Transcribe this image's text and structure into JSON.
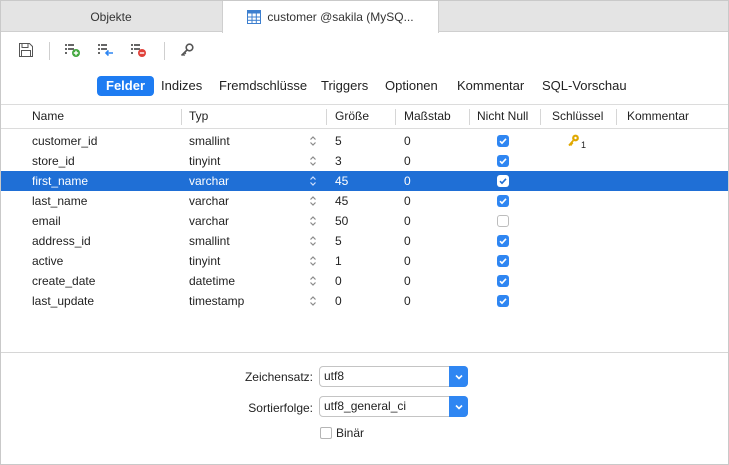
{
  "tabs": {
    "inactive_label": "Objekte",
    "active_label": "customer @sakila (MySQ..."
  },
  "subtabs": [
    "Felder",
    "Indizes",
    "Fremdschlüsse",
    "Triggers",
    "Optionen",
    "Kommentar",
    "SQL-Vorschau"
  ],
  "columns": [
    "Name",
    "Typ",
    "Größe",
    "Maßstab",
    "Nicht Null",
    "Schlüssel",
    "Kommentar"
  ],
  "rows": [
    {
      "name": "customer_id",
      "type": "smallint",
      "size": "5",
      "scale": "0",
      "not_null": true,
      "key": "1"
    },
    {
      "name": "store_id",
      "type": "tinyint",
      "size": "3",
      "scale": "0",
      "not_null": true,
      "key": ""
    },
    {
      "name": "first_name",
      "type": "varchar",
      "size": "45",
      "scale": "0",
      "not_null": true,
      "key": ""
    },
    {
      "name": "last_name",
      "type": "varchar",
      "size": "45",
      "scale": "0",
      "not_null": true,
      "key": ""
    },
    {
      "name": "email",
      "type": "varchar",
      "size": "50",
      "scale": "0",
      "not_null": false,
      "key": ""
    },
    {
      "name": "address_id",
      "type": "smallint",
      "size": "5",
      "scale": "0",
      "not_null": true,
      "key": ""
    },
    {
      "name": "active",
      "type": "tinyint",
      "size": "1",
      "scale": "0",
      "not_null": true,
      "key": ""
    },
    {
      "name": "create_date",
      "type": "datetime",
      "size": "0",
      "scale": "0",
      "not_null": true,
      "key": ""
    },
    {
      "name": "last_update",
      "type": "timestamp",
      "size": "0",
      "scale": "0",
      "not_null": true,
      "key": ""
    }
  ],
  "selected_row": 2,
  "form": {
    "charset_label": "Zeichensatz:",
    "charset_value": "utf8",
    "collation_label": "Sortierfolge:",
    "collation_value": "utf8_general_ci",
    "binary_label": "Binär"
  },
  "colors": {
    "accent": "#1e7cf2",
    "selection": "#1f6fd6",
    "key_icon": "#e0a800"
  },
  "icons": {
    "toolbar": [
      "save-icon",
      "add-field-icon",
      "insert-field-icon",
      "delete-field-icon",
      "primary-key-icon"
    ]
  }
}
